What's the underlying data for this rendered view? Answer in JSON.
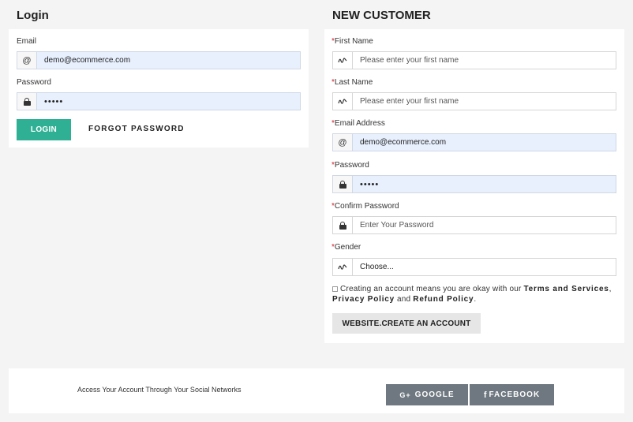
{
  "login": {
    "heading": "Login",
    "email_label": "Email",
    "email_value": "demo@ecommerce.com",
    "password_label": "Password",
    "password_value": "•••••",
    "login_button": "LOGIN",
    "forgot_link": "FORGOT PASSWORD"
  },
  "register": {
    "heading": "NEW CUSTOMER",
    "required_mark": "*",
    "first_name_label": "First Name",
    "first_name_placeholder": "Please enter your first name",
    "last_name_label": "Last Name",
    "last_name_placeholder": "Please enter your first name",
    "email_label": "Email Address",
    "email_value": "demo@ecommerce.com",
    "password_label": "Password",
    "password_value": "•••••",
    "confirm_label": "Confirm Password",
    "confirm_placeholder": "Enter Your Password",
    "gender_label": "Gender",
    "gender_value": "Choose...",
    "terms_prefix": "Creating an account means you are okay with our",
    "terms_link": "Terms and Services",
    "terms_comma": ",",
    "privacy_link": "Privacy Policy",
    "terms_and": "and",
    "refund_link": "Refund Policy",
    "terms_period": ".",
    "create_button": "WEBSITE.CREATE AN ACCOUNT"
  },
  "social": {
    "text": "Access Your Account Through Your Social Networks",
    "google_label": "GOOGLE",
    "facebook_label": "FACEBOOK"
  },
  "icons": {
    "at": "@",
    "signature": "~",
    "lock": "lock-icon",
    "google": "G+",
    "facebook": "f"
  },
  "colors": {
    "login_button": "#2fb094",
    "social_button": "#6f7880",
    "required": "#d0202a",
    "filled_input": "#e8f0fe"
  }
}
